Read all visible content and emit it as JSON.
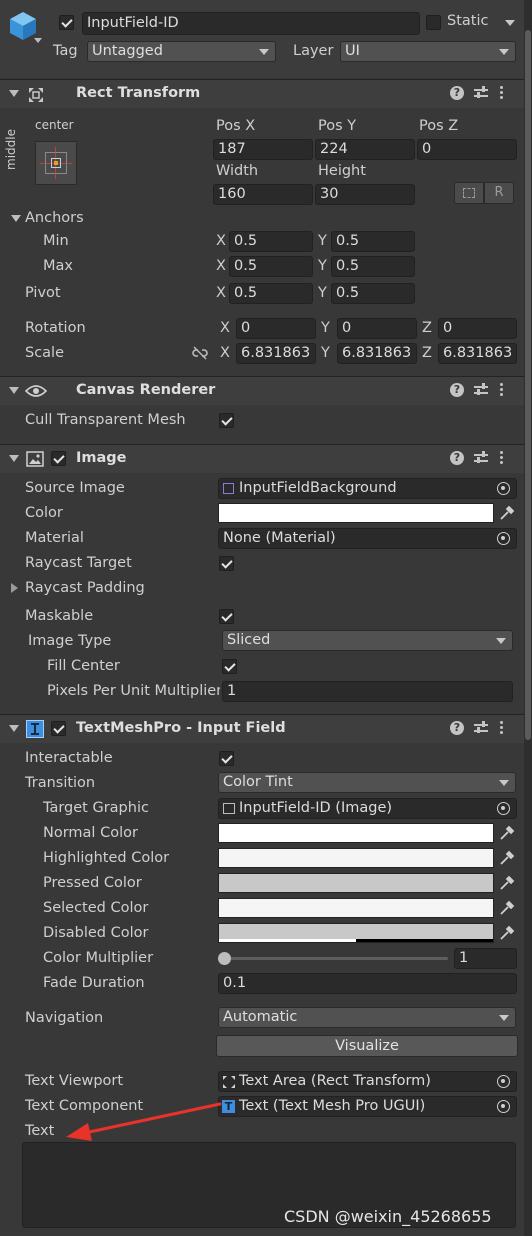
{
  "gameobject": {
    "name": "InputField-ID",
    "static_label": "Static",
    "tag_label": "Tag",
    "tag_value": "Untagged",
    "layer_label": "Layer",
    "layer_value": "UI"
  },
  "rect_transform": {
    "title": "Rect Transform",
    "anchor_preset_top": "center",
    "anchor_preset_side": "middle",
    "pos_x_label": "Pos X",
    "pos_y_label": "Pos Y",
    "pos_z_label": "Pos Z",
    "pos_x": "187",
    "pos_y": "224",
    "pos_z": "0",
    "width_label": "Width",
    "height_label": "Height",
    "width": "160",
    "height": "30",
    "r_button": "R",
    "anchors_label": "Anchors",
    "min_label": "Min",
    "max_label": "Max",
    "pivot_label": "Pivot",
    "x": "X",
    "y": "Y",
    "z": "Z",
    "min_x": "0.5",
    "min_y": "0.5",
    "max_x": "0.5",
    "max_y": "0.5",
    "pivot_x": "0.5",
    "pivot_y": "0.5",
    "rotation_label": "Rotation",
    "rot_x": "0",
    "rot_y": "0",
    "rot_z": "0",
    "scale_label": "Scale",
    "scale_x": "6.831863",
    "scale_y": "6.831863",
    "scale_z": "6.831863"
  },
  "canvas_renderer": {
    "title": "Canvas Renderer",
    "cull_label": "Cull Transparent Mesh"
  },
  "image": {
    "title": "Image",
    "source_image_label": "Source Image",
    "source_image_value": "InputFieldBackground",
    "color_label": "Color",
    "material_label": "Material",
    "material_value": "None (Material)",
    "raycast_target_label": "Raycast Target",
    "raycast_padding_label": "Raycast Padding",
    "maskable_label": "Maskable",
    "image_type_label": "Image Type",
    "image_type_value": "Sliced",
    "fill_center_label": "Fill Center",
    "ppu_label": "Pixels Per Unit Multiplier",
    "ppu_value": "1"
  },
  "input_field": {
    "title": "TextMeshPro - Input Field",
    "interactable_label": "Interactable",
    "transition_label": "Transition",
    "transition_value": "Color Tint",
    "target_graphic_label": "Target Graphic",
    "target_graphic_value": "InputField-ID (Image)",
    "normal_color_label": "Normal Color",
    "highlighted_color_label": "Highlighted Color",
    "pressed_color_label": "Pressed Color",
    "selected_color_label": "Selected Color",
    "disabled_color_label": "Disabled Color",
    "color_multiplier_label": "Color Multiplier",
    "color_multiplier_value": "1",
    "color_multiplier_fraction": 0.0,
    "fade_duration_label": "Fade Duration",
    "fade_duration_value": "0.1",
    "navigation_label": "Navigation",
    "navigation_value": "Automatic",
    "visualize_label": "Visualize",
    "text_viewport_label": "Text Viewport",
    "text_viewport_value": "Text Area (Rect Transform)",
    "text_component_label": "Text Component",
    "text_component_value": "Text (Text Mesh Pro UGUI)",
    "text_label": "Text"
  },
  "watermark": "CSDN @weixin_45268655",
  "colors": {
    "panel": "#383838",
    "header": "#3e3e3e",
    "field": "#2a2a2a",
    "accent_blue": "#3e8ede",
    "arrow_red": "#e8322a",
    "swatch_white": "#ffffff",
    "swatch_light": "#f5f5f5",
    "swatch_pressed": "#c8c8c8",
    "swatch_disabled": "#c8c8c8"
  }
}
